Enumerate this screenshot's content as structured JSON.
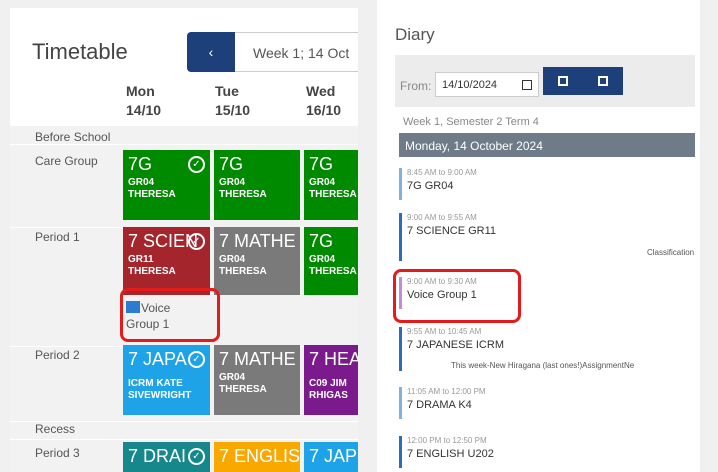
{
  "timetable": {
    "title": "Timetable",
    "prev_icon": "chevron-left-icon",
    "prev_glyph": "‹",
    "week_label": "Week 1; 14 Oct",
    "days": [
      {
        "dow": "Mon",
        "date": "14/10"
      },
      {
        "dow": "Tue",
        "date": "15/10"
      },
      {
        "dow": "Wed",
        "date": "16/10"
      }
    ],
    "rows": [
      "Before School",
      "Care Group",
      "Period 1",
      "Period 2",
      "Recess",
      "Period 3"
    ],
    "check_glyph": "✓",
    "tiles": {
      "care_mon": {
        "name": "7G",
        "room": "GR04",
        "teacher": "THERESA",
        "color": "#008a00"
      },
      "care_tue": {
        "name": "7G",
        "room": "GR04",
        "teacher": "THERESA",
        "color": "#008a00"
      },
      "care_wed": {
        "name": "7G",
        "room": "GR04",
        "teacher": "THERESA",
        "color": "#008a00"
      },
      "p1_mon": {
        "name": "7 SCIEN",
        "room": "GR11",
        "teacher": "THERESA",
        "color": "#a4262c"
      },
      "p1_tue": {
        "name": "7 MATHE",
        "room": "GR04",
        "teacher": "THERESA",
        "color": "#7a7a7a"
      },
      "p1_wed": {
        "name": "7G",
        "room": "GR04",
        "teacher": "THERESA",
        "color": "#008a00"
      },
      "p2_mon": {
        "name": "7 JAPA",
        "room": "ICRM KATE",
        "teacher": "SIVEWRIGHT",
        "color": "#1fa3e8"
      },
      "p2_tue": {
        "name": "7 MATHE",
        "room": "GR04",
        "teacher": "THERESA",
        "color": "#7a7a7a"
      },
      "p2_wed": {
        "name": "7 HEA",
        "room": "C09 JIM",
        "teacher": "RHIGAS",
        "color": "#7b1a8c"
      },
      "p3_mon": {
        "name": "7 DRAI",
        "color": "#16878a"
      },
      "p3_tue": {
        "name": "7 ENGLIS",
        "color": "#f9a800"
      },
      "p3_wed": {
        "name": "7 JAP",
        "color": "#1fa3e8"
      }
    },
    "event": {
      "line1": "Voice",
      "line2": "Group 1",
      "icon": "calendar-icon"
    }
  },
  "diary": {
    "title": "Diary",
    "from_label": "From:",
    "date_value": "14/10/2024",
    "week_info": "Week 1, Semester 2 Term 4",
    "day_header": "Monday, 14 October 2024",
    "entries": [
      {
        "time": "8:45 AM to 9:00 AM",
        "title": "7G GR04",
        "color": "#7fb0e0"
      },
      {
        "time": "9:00 AM to 9:55 AM",
        "title": "7 SCIENCE GR11",
        "note": "Classification",
        "color": "#2b6cc0"
      },
      {
        "time": "9:00 AM to 9:30 AM",
        "title": "Voice Group 1",
        "color": "#c48ad8"
      },
      {
        "time": "9:55 AM to 10:45 AM",
        "title": "7 JAPANESE ICRM",
        "note": "This week-New Hiragana (last ones!)AssignmentNe",
        "color": "#2b6cc0"
      },
      {
        "time": "11:05 AM to 12:00 PM",
        "title": "7 DRAMA K4",
        "color": "#7fb0e0"
      },
      {
        "time": "12:00 PM to 12:50 PM",
        "title": "7 ENGLISH U202",
        "color": "#2b6cc0"
      }
    ]
  }
}
